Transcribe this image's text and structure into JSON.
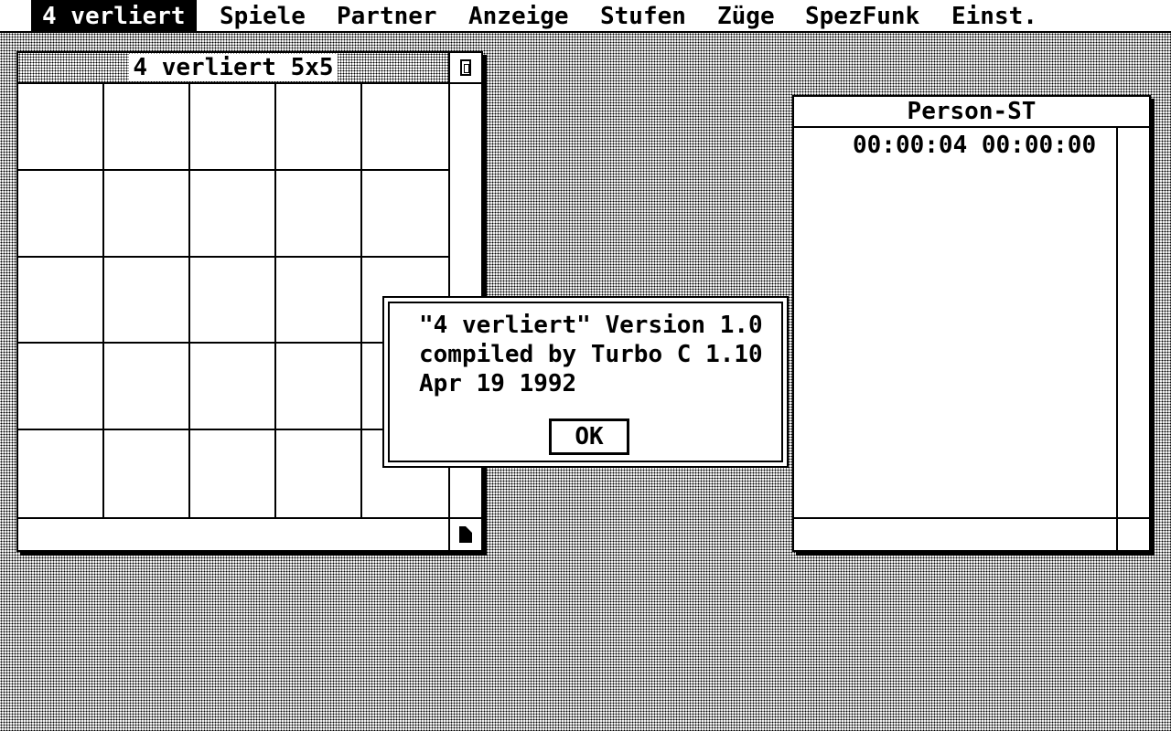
{
  "menubar": {
    "items": [
      {
        "label": "4 verliert"
      },
      {
        "label": "Spiele"
      },
      {
        "label": "Partner"
      },
      {
        "label": "Anzeige"
      },
      {
        "label": "Stufen"
      },
      {
        "label": "Züge"
      },
      {
        "label": "SpezFunk"
      },
      {
        "label": "Einst."
      }
    ]
  },
  "game_window": {
    "title": "4 verliert 5x5",
    "board": {
      "rows": 5,
      "columns": 5
    }
  },
  "player_window": {
    "title": "Person-ST",
    "times": "00:00:04 00:00:00"
  },
  "about_dialog": {
    "lines": [
      "\"4 verliert\" Version 1.0",
      "compiled by Turbo C 1.10",
      "Apr 19 1992"
    ],
    "ok_label": "OK"
  }
}
